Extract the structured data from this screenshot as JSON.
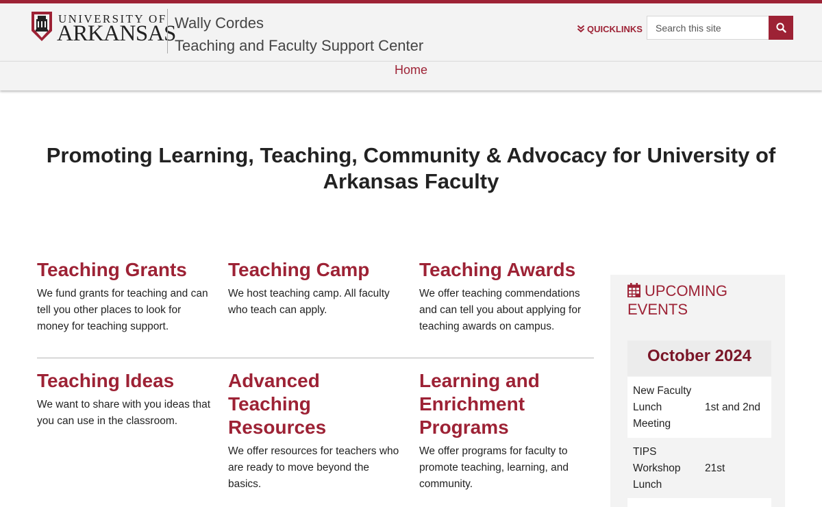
{
  "colors": {
    "accent": "#9d2235",
    "month": "#7a1628",
    "header_bg": "#f3f3f3"
  },
  "header": {
    "logo": {
      "line1": "UNIVERSITY OF",
      "line2": "ARKANSAS",
      "icon": "old-main-seal"
    },
    "site_name_line1": "Wally Cordes",
    "site_name_line2": "Teaching and Faculty Support Center",
    "quicklinks_label": "QUICKLINKS",
    "search_placeholder": "Search this site"
  },
  "nav": {
    "home": "Home"
  },
  "hero": {
    "title": "Promoting Learning, Teaching, Community & Advocacy for University of Arkansas Faculty"
  },
  "cards": [
    {
      "title": "Teaching Grants",
      "text": "We fund grants for teaching and can tell you other places to look for money for teaching support."
    },
    {
      "title": "Teaching Camp",
      "text": "We host teaching camp. All faculty who teach can apply."
    },
    {
      "title": "Teaching Awards",
      "text": "We offer teaching commendations and can tell you about applying for teaching awards on campus."
    },
    {
      "title": "Teaching Ideas",
      "text": "We want to share with you ideas that you can use in the classroom."
    },
    {
      "title": "Advanced Teaching Resources",
      "text": "We offer resources for teachers who are ready to move beyond the basics."
    },
    {
      "title": "Learning and Enrichment Programs",
      "text": "We offer programs for faculty to promote teaching, learning, and community."
    }
  ],
  "events": {
    "title": "UPCOMING EVENTS",
    "month": "October 2024",
    "items": [
      {
        "name": "New Faculty Lunch Meeting",
        "date": "1st and 2nd"
      },
      {
        "name": "TIPS Workshop Lunch",
        "date": "21st"
      }
    ]
  }
}
